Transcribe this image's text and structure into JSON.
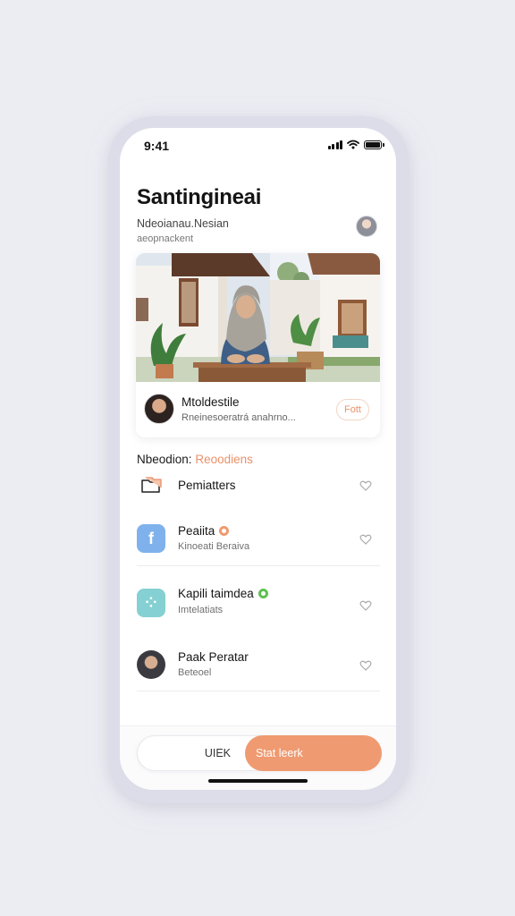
{
  "status_bar": {
    "time": "9:41"
  },
  "header": {
    "title": "Santingineai",
    "subtitle": "Ndeoianau.Nesian",
    "caption": "aeopnackent"
  },
  "hero": {
    "name": "Mtoldestile",
    "description": "Rneinesoeratrá anahrno...",
    "button_label": "Fott"
  },
  "section": {
    "label": "Nbeodion:",
    "accent": "Reoodiens"
  },
  "list": [
    {
      "title": "Pemiatters",
      "subtitle": ""
    },
    {
      "title": "Peaiita",
      "subtitle": "Kinoeati Beraiva"
    },
    {
      "title": "Kapili taimdea",
      "subtitle": "Imtelatiats"
    },
    {
      "title": "Paak Peratar",
      "subtitle": "Beteoel"
    }
  ],
  "bottom": {
    "left_label": "UIEK",
    "right_label": "Stat leerk"
  },
  "colors": {
    "accent": "#ef9a70",
    "blue_icon": "#7fb2ec",
    "teal_icon": "#85d0d2",
    "verified_green": "#5cc24f",
    "orange_badge": "#ef9a70"
  }
}
